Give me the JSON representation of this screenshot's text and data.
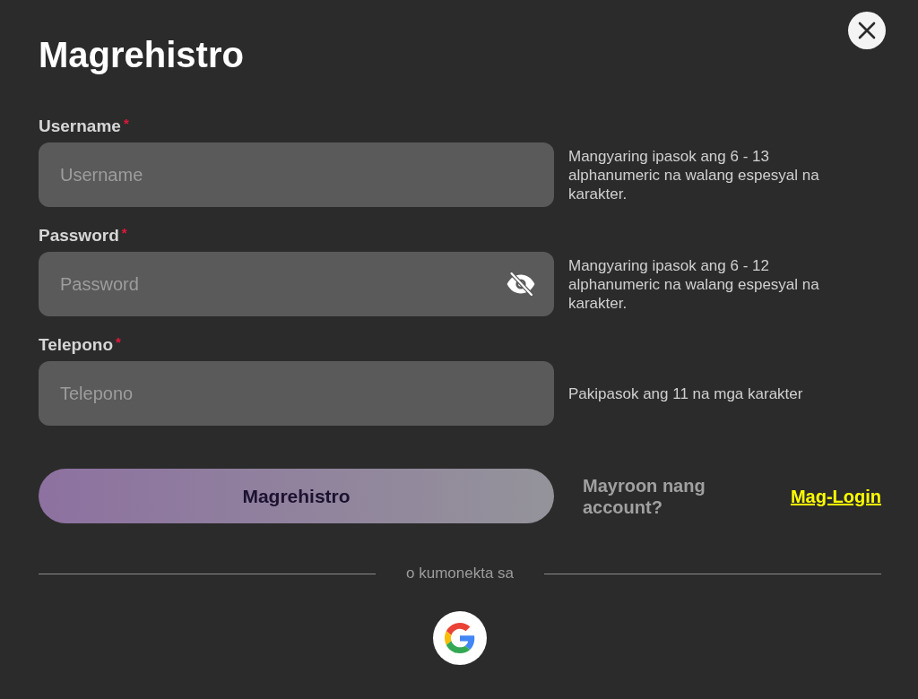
{
  "dialog": {
    "title": "Magrehistro"
  },
  "fields": [
    {
      "kind": "text",
      "label": "Username",
      "required_mark": "*",
      "placeholder": "Username",
      "hint": "Mangyaring ipasok ang 6 - 13 alphanumeric na walang espesyal na karakter."
    },
    {
      "kind": "password",
      "label": "Password",
      "required_mark": "*",
      "placeholder": "Password",
      "password_visible": false,
      "hint": "Mangyaring ipasok ang 6 - 12 alphanumeric na walang espesyal na karakter."
    },
    {
      "kind": "tel",
      "label": "Telepono",
      "required_mark": "*",
      "placeholder": "Telepono",
      "hint": "Pakipasok ang 11 na mga karakter"
    }
  ],
  "submit_button": "Magrehistro",
  "login_prompt": {
    "text": "Mayroon nang account?",
    "link": "Mag-Login"
  },
  "divider_text": "o kumonekta sa",
  "social_buttons": [
    {
      "kind": "google"
    }
  ]
}
